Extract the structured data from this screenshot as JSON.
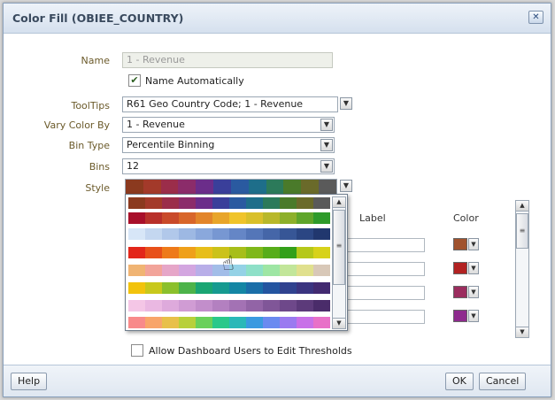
{
  "dialog": {
    "title": "Color Fill (OBIEE_COUNTRY)"
  },
  "form": {
    "name_label": "Name",
    "name_value": "1 - Revenue",
    "name_auto_label": "Name Automatically",
    "name_auto_checked": true,
    "tooltips_label": "ToolTips",
    "tooltips_value": "R61 Geo Country Code; 1 - Revenue",
    "vary_label": "Vary Color By",
    "vary_value": "1 - Revenue",
    "bintype_label": "Bin Type",
    "bintype_value": "Percentile Binning",
    "bins_label": "Bins",
    "bins_value": "12",
    "style_label": "Style"
  },
  "table": {
    "label_header": "Label",
    "color_header": "Color",
    "rows": [
      {
        "color": "#a0522d"
      },
      {
        "color": "#b22222"
      },
      {
        "color": "#9b2d5e"
      },
      {
        "color": "#8e2a8e"
      }
    ]
  },
  "style_selected_palette": [
    "#8b3a1f",
    "#a33a2a",
    "#9b2d4a",
    "#8b2c6a",
    "#6b2d8a",
    "#3a3f9a",
    "#2a5aa0",
    "#1e6e8a",
    "#2c7a5a",
    "#4a7a2a",
    "#6a6a2a",
    "#5a5a5a"
  ],
  "palette_options": [
    [
      "#a80f2a",
      "#b8302a",
      "#c94a2a",
      "#d8662a",
      "#e2852a",
      "#e8a52a",
      "#f0c42a",
      "#d9c02a",
      "#b8b82a",
      "#8db02a",
      "#5fa52a",
      "#2e9a2a"
    ],
    [
      "#d7e6f7",
      "#c4d7f0",
      "#b1c8ea",
      "#9db8e3",
      "#8aa8dc",
      "#7797d2",
      "#6586c6",
      "#5476b8",
      "#4566a8",
      "#375696",
      "#2b4683",
      "#21376e"
    ],
    [
      "#e3261a",
      "#e8501a",
      "#ee7a1a",
      "#efa01a",
      "#e7be1a",
      "#cbc21a",
      "#a7be1a",
      "#7fb81a",
      "#57ad1a",
      "#33a01a",
      "#b5c81a",
      "#d7d21a"
    ],
    [
      "#f0b473",
      "#f2a49a",
      "#e6a6c8",
      "#d3a6e0",
      "#b8aee8",
      "#a2bde8",
      "#94d2e6",
      "#8ee0c8",
      "#9ee6a4",
      "#c2e69a",
      "#e0e08e",
      "#d8c8b8"
    ],
    [
      "#f2c30c",
      "#c8c81c",
      "#8bc02c",
      "#4db34a",
      "#1aa573",
      "#169a90",
      "#1486a4",
      "#1a6ea8",
      "#2455a0",
      "#30428f",
      "#3a3480",
      "#422a70"
    ],
    [
      "#f4c6e6",
      "#eab8e2",
      "#deaadc",
      "#d09cd4",
      "#c28ecb",
      "#b380c0",
      "#a372b4",
      "#9264a6",
      "#805698",
      "#6e488a",
      "#5c3a7a",
      "#4a2c6a"
    ],
    [
      "#f88a8a",
      "#f8a56a",
      "#e8c04a",
      "#b8d03a",
      "#6ad05a",
      "#2ac88a",
      "#2ab8b8",
      "#3a9ae0",
      "#6a8af0",
      "#9a7af0",
      "#c870e8",
      "#e870c8"
    ]
  ],
  "checkbox_edit": {
    "label": "Allow Dashboard Users to Edit Thresholds",
    "checked": false
  },
  "buttons": {
    "help": "Help",
    "ok": "OK",
    "cancel": "Cancel"
  },
  "icons": {
    "close": "close-icon",
    "dropdown": "chevron-down-icon",
    "hand_cursor": "hand-pointer-icon"
  }
}
